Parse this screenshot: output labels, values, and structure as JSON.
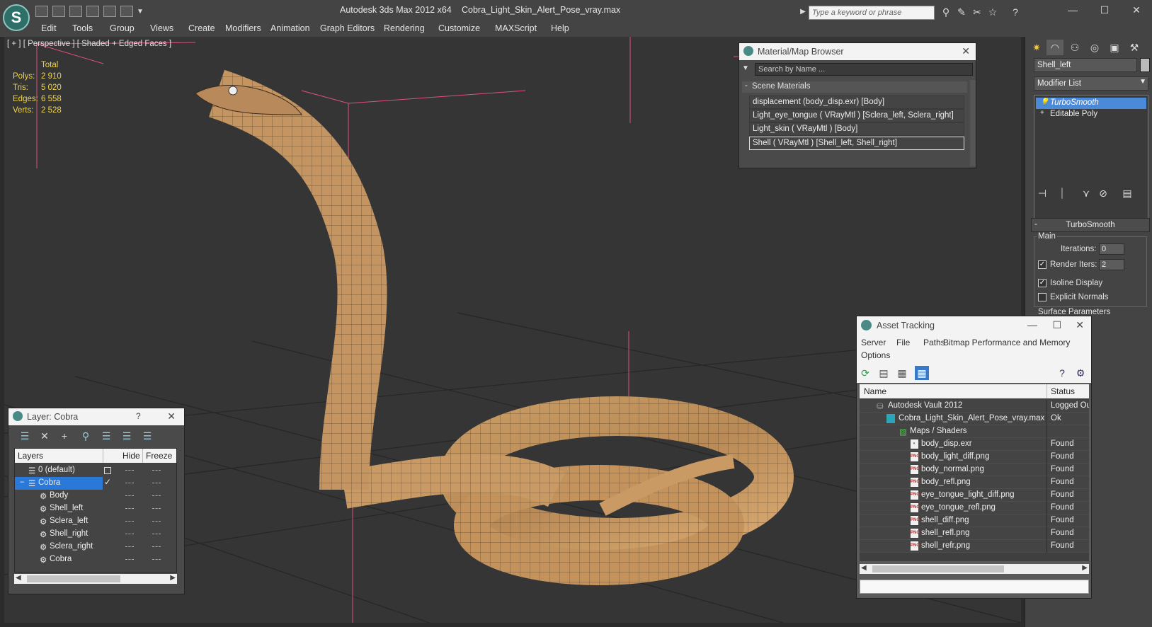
{
  "titlebar": {
    "app_title": "Autodesk 3ds Max  2012 x64",
    "file_title": "Cobra_Light_Skin_Alert_Pose_vray.max",
    "search_placeholder": "Type a keyword or phrase"
  },
  "menu": [
    "Edit",
    "Tools",
    "Group",
    "Views",
    "Create",
    "Modifiers",
    "Animation",
    "Graph Editors",
    "Rendering",
    "Customize",
    "MAXScript",
    "Help"
  ],
  "viewport": {
    "label": "[ + ] [ Perspective ] [ Shaded + Edged Faces ]",
    "stats": {
      "header": "Total",
      "polys_label": "Polys:",
      "polys": "2 910",
      "tris_label": "Tris:",
      "tris": "5 020",
      "edges_label": "Edges:",
      "edges": "6 558",
      "verts_label": "Verts:",
      "verts": "2 528"
    }
  },
  "command_panel": {
    "object_name": "Shell_left",
    "modifier_list": "Modifier List",
    "stack": [
      "TurboSmooth",
      "Editable Poly"
    ],
    "rollout_title": "TurboSmooth",
    "main_group": "Main",
    "iterations_label": "Iterations:",
    "iterations": "0",
    "render_iters_label": "Render Iters:",
    "render_iters": "2",
    "isoline_label": "Isoline Display",
    "explicit_normals_label": "Explicit Normals",
    "surface_params": "Surface Parameters"
  },
  "material_browser": {
    "title": "Material/Map Browser",
    "search_placeholder": "Search by Name ...",
    "section": "Scene Materials",
    "items": [
      "displacement (body_disp.exr) [Body]",
      "Light_eye_tongue  ( VRayMtl )  [Sclera_left, Sclera_right]",
      "Light_skin  ( VRayMtl )  [Body]",
      "Shell  ( VRayMtl )  [Shell_left, Shell_right]"
    ]
  },
  "asset_tracking": {
    "title": "Asset Tracking",
    "menu": [
      "Server",
      "File",
      "Paths",
      "Bitmap Performance and Memory",
      "Options"
    ],
    "col_name": "Name",
    "col_status": "Status",
    "rows": [
      {
        "name": "Autodesk Vault 2012",
        "status": "Logged Ou"
      },
      {
        "name": "Cobra_Light_Skin_Alert_Pose_vray.max",
        "status": "Ok"
      },
      {
        "name": "Maps / Shaders",
        "status": ""
      },
      {
        "name": "body_disp.exr",
        "status": "Found"
      },
      {
        "name": "body_light_diff.png",
        "status": "Found"
      },
      {
        "name": "body_normal.png",
        "status": "Found"
      },
      {
        "name": "body_refl.png",
        "status": "Found"
      },
      {
        "name": "eye_tongue_light_diff.png",
        "status": "Found"
      },
      {
        "name": "eye_tongue_refl.png",
        "status": "Found"
      },
      {
        "name": "shell_diff.png",
        "status": "Found"
      },
      {
        "name": "shell_refl.png",
        "status": "Found"
      },
      {
        "name": "shell_refr.png",
        "status": "Found"
      }
    ]
  },
  "layers": {
    "title": "Layer: Cobra",
    "help": "?",
    "col_layers": "Layers",
    "col_hide": "Hide",
    "col_freeze": "Freeze",
    "rows": [
      "0 (default)",
      "Cobra",
      "Body",
      "Shell_left",
      "Sclera_left",
      "Shell_right",
      "Sclera_right",
      "Cobra"
    ]
  },
  "colors": {
    "selection": "#2a78d8",
    "stats_yellow": "#f0d54a",
    "gizmo_pink": "#e0507a"
  }
}
